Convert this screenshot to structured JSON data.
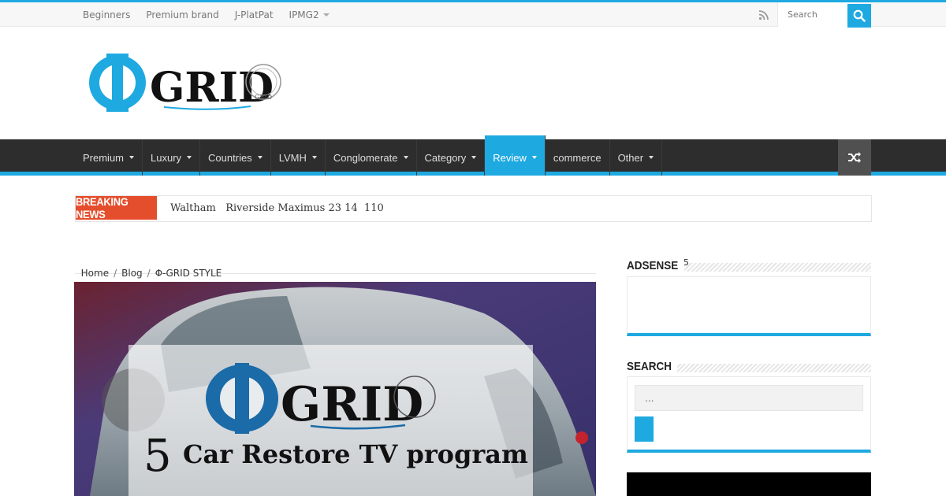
{
  "topnav": {
    "items": [
      "Beginners",
      "Premium brand",
      "J-PlatPat",
      "IPMG2"
    ],
    "search_placeholder": "Search"
  },
  "mainnav": {
    "items": [
      {
        "label": "Premium",
        "dropdown": true
      },
      {
        "label": "Luxury",
        "dropdown": true
      },
      {
        "label": "Countries",
        "dropdown": true
      },
      {
        "label": "LVMH",
        "dropdown": true
      },
      {
        "label": "Conglomerate",
        "dropdown": true
      },
      {
        "label": "Category",
        "dropdown": true
      },
      {
        "label": "Review",
        "dropdown": true,
        "active": true
      },
      {
        "label": "commerce",
        "dropdown": false
      },
      {
        "label": "Other",
        "dropdown": true
      }
    ]
  },
  "logo": {
    "text": "GRID",
    "seal_text": "GRID"
  },
  "breaking": {
    "label": "BREAKING NEWS",
    "text": "Waltham   Riverside Maximus 23 14  110"
  },
  "breadcrumb": {
    "home": "Home",
    "blog": "Blog",
    "current": "Φ-GRID STYLE"
  },
  "featured": {
    "logo_text": "GRID",
    "caption_number": "5",
    "caption_text": "Car Restore TV program"
  },
  "sidebar": {
    "adsense": {
      "title": "ADSENSE",
      "count": "5"
    },
    "search": {
      "title": "SEARCH",
      "placeholder": "..."
    }
  },
  "colors": {
    "accent": "#1ea9e1",
    "nav_bg": "#2d2d2d",
    "breaking": "#e54e2c"
  }
}
